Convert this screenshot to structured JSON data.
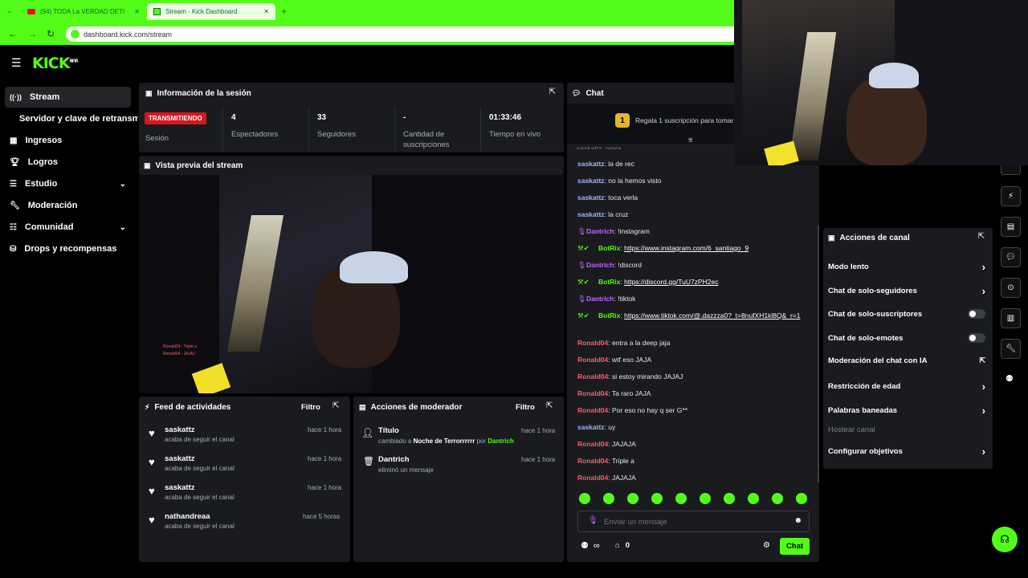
{
  "browser": {
    "tabs": [
      {
        "label": "(94) TODA La VERDAD DETI"
      },
      {
        "label": "Stream - Kick Dashboard"
      }
    ],
    "url": "dashboard.kick.com/stream"
  },
  "brand": {
    "logo": "KICK",
    "logo_badge": "BETA",
    "accent": "#53fc18"
  },
  "sidebar": {
    "items": [
      {
        "label": "Stream",
        "icon": "broadcast-icon"
      },
      {
        "label": "Servidor y clave de retransm"
      },
      {
        "label": "Ingresos",
        "icon": "chart-icon"
      },
      {
        "label": "Logros",
        "icon": "trophy-icon"
      },
      {
        "label": "Estudio",
        "icon": "studio-icon"
      },
      {
        "label": "Moderación",
        "icon": "wrench-icon"
      },
      {
        "label": "Comunidad",
        "icon": "community-icon"
      },
      {
        "label": "Drops y recompensas",
        "icon": "drops-icon"
      }
    ]
  },
  "session": {
    "title": "Información de la sesión",
    "status_badge": "TRANSMITIENDO",
    "status_label": "Sesión",
    "stats": [
      {
        "value": "4",
        "label": "Espectadores"
      },
      {
        "value": "33",
        "label": "Seguidores"
      },
      {
        "value": "-",
        "label": "Cantidad de suscripciones"
      },
      {
        "value": "01:33:46",
        "label": "Tiempo en vivo"
      }
    ]
  },
  "preview": {
    "title": "Vista previa del stream",
    "overlay_lines": [
      "Ronald04 : Triple a",
      "Ronald04 : JAJAJ"
    ]
  },
  "feed": {
    "title": "Feed de actividades",
    "filter": "Filtro",
    "items": [
      {
        "user": "saskattz",
        "action": "acaba de seguir el canal",
        "time": "hace 1 hora"
      },
      {
        "user": "saskattz",
        "action": "acaba de seguir el canal",
        "time": "hace 1 hora"
      },
      {
        "user": "saskattz",
        "action": "acaba de seguir el canal",
        "time": "hace 1 hora"
      },
      {
        "user": "nathandreaa",
        "action": "acaba de seguir el canal",
        "time": "hace 5 horas"
      }
    ]
  },
  "mod_actions": {
    "title": "Acciones de moderador",
    "filter": "Filtro",
    "items": [
      {
        "title": "Título",
        "pre": "cambiado a",
        "target": "Noche de Terrorrrrrr",
        "by_word": "por",
        "by": "Dantrich",
        "time": "hace 1 hora"
      },
      {
        "title": "Dantrich",
        "desc": "eliminó un mensaje",
        "time": "hace 1 hora"
      }
    ]
  },
  "chat": {
    "title": "Chat",
    "promo_count": "1",
    "promo_text": "Regala 1 suscripción para tomar",
    "partial_top": "saskattz: jajaja",
    "messages": [
      {
        "user": "saskattz",
        "cls": "u-blue",
        "text": "la de rec"
      },
      {
        "user": "saskattz",
        "cls": "u-blue",
        "text": "no la hemos visto"
      },
      {
        "user": "saskattz",
        "cls": "u-blue",
        "text": "toca verla"
      },
      {
        "user": "saskattz",
        "cls": "u-blue",
        "text": "la cruz"
      },
      {
        "user": "Dantrich",
        "cls": "u-purple",
        "text": "!instagram"
      },
      {
        "user": "BotRix",
        "cls": "u-green",
        "text": "https://www.instagram.com/6_santiago_9"
      },
      {
        "user": "Dantrich",
        "cls": "u-purple",
        "text": "!discord"
      },
      {
        "user": "BotRix",
        "cls": "u-green",
        "text": "https://discord.gg/TuU7zPH2ec"
      },
      {
        "user": "Dantrich",
        "cls": "u-purple",
        "text": "!tiktok"
      },
      {
        "user": "BotRix",
        "cls": "u-green",
        "text": "https://www.tiktok.com/@.dazzza0?_t=8nufXH1kl8Q&_r=1"
      },
      {
        "user": "Ronald04",
        "cls": "u-red",
        "text": "entra a la deep jaja"
      },
      {
        "user": "Ronald04",
        "cls": "u-red",
        "text": "wtf eso JAJA"
      },
      {
        "user": "Ronald04",
        "cls": "u-red",
        "text": "si estoy mirando JAJAJ"
      },
      {
        "user": "Ronald04",
        "cls": "u-red",
        "text": "Ta raro JAJA"
      },
      {
        "user": "Ronald04",
        "cls": "u-red",
        "text": "Por eso no hay q ser G**"
      },
      {
        "user": "saskattz",
        "cls": "u-blue",
        "text": "uy"
      },
      {
        "user": "Ronald04",
        "cls": "u-red",
        "text": "JAJAJA"
      },
      {
        "user": "Ronald04",
        "cls": "u-red",
        "text": "Triple a"
      },
      {
        "user": "Ronald04",
        "cls": "u-red",
        "text": "JAJAJA"
      }
    ],
    "input_placeholder": "Enviar un mensaje",
    "users_count": "∞",
    "store_count": "0",
    "send_label": "Chat"
  },
  "channel_actions": {
    "title": "Acciones de canal",
    "items": [
      {
        "label": "Modo lento",
        "control": "chevron"
      },
      {
        "label": "Chat de solo-seguidores",
        "control": "chevron"
      },
      {
        "label": "Chat de solo-suscriptores",
        "control": "toggle"
      },
      {
        "label": "Chat de solo-emotes",
        "control": "toggle"
      },
      {
        "label": "Moderación del chat con IA",
        "control": "external"
      },
      {
        "label": "Restricción de edad",
        "control": "chevron"
      },
      {
        "label": "Palabras baneadas",
        "control": "chevron"
      },
      {
        "label": "Hostear canal",
        "control": "none"
      },
      {
        "label": "Configurar objetivos",
        "control": "chevron"
      }
    ]
  }
}
